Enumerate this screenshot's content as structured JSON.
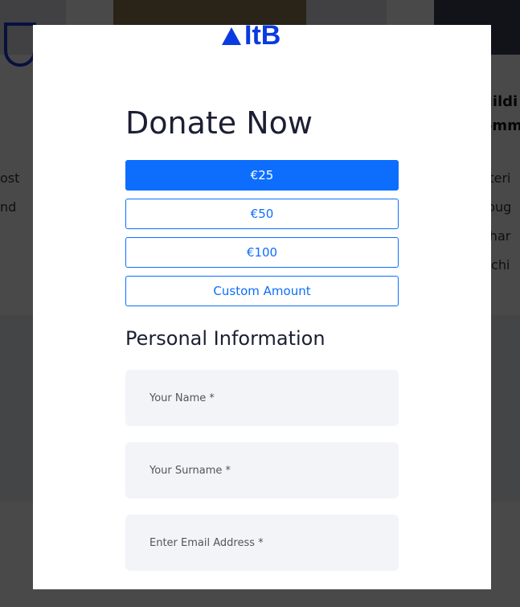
{
  "background": {
    "text_left": [
      "ost",
      "nd"
    ],
    "text_right_heading": [
      "uildi",
      "omm"
    ],
    "text_right": [
      "steri",
      "roug",
      "char",
      "richi"
    ]
  },
  "modal": {
    "logo_text": "ItB",
    "title": "Donate Now",
    "amounts": [
      {
        "label": "€25",
        "selected": true
      },
      {
        "label": "€50",
        "selected": false
      },
      {
        "label": "€100",
        "selected": false
      },
      {
        "label": "Custom Amount",
        "selected": false
      }
    ],
    "section_title": "Personal Information",
    "fields": [
      {
        "placeholder": "Your Name *"
      },
      {
        "placeholder": "Your Surname *"
      },
      {
        "placeholder": "Enter Email Address *"
      }
    ]
  },
  "colors": {
    "accent": "#0d6efd",
    "logo": "#0a3be0"
  }
}
